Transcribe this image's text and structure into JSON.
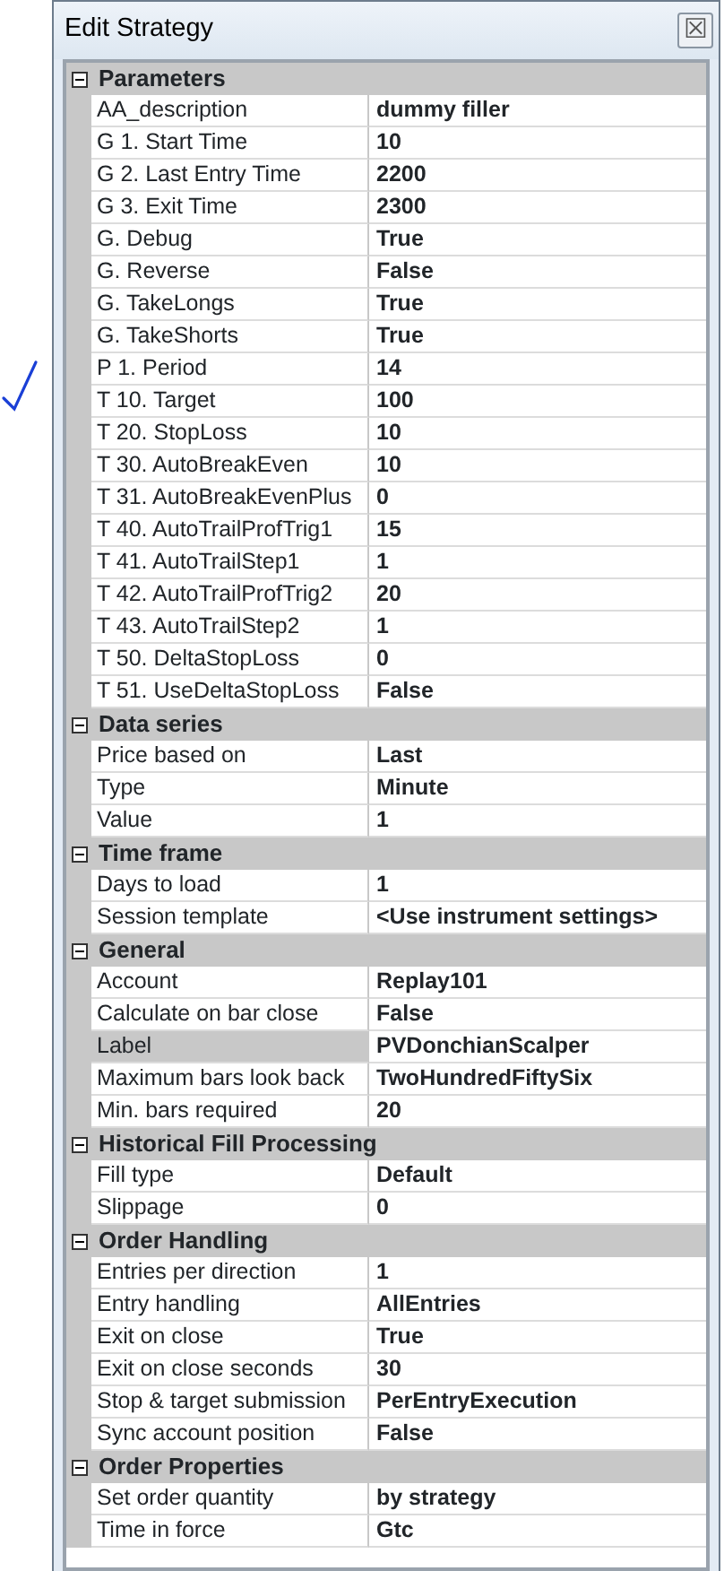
{
  "window": {
    "title": "Edit Strategy",
    "close": "☒"
  },
  "categories": [
    {
      "name": "Parameters",
      "expanded": true,
      "rows": [
        {
          "label": "AA_description",
          "value": "dummy filler",
          "selected": false
        },
        {
          "label": "G 1. Start Time",
          "value": "10",
          "selected": false
        },
        {
          "label": "G 2. Last Entry Time",
          "value": "2200",
          "selected": false
        },
        {
          "label": "G 3. Exit Time",
          "value": "2300",
          "selected": false
        },
        {
          "label": "G. Debug",
          "value": "True",
          "selected": false
        },
        {
          "label": "G. Reverse",
          "value": "False",
          "selected": false
        },
        {
          "label": "G. TakeLongs",
          "value": "True",
          "selected": false
        },
        {
          "label": "G. TakeShorts",
          "value": "True",
          "selected": false
        },
        {
          "label": "P 1. Period",
          "value": "14",
          "selected": false
        },
        {
          "label": "T 10. Target",
          "value": "100",
          "selected": false
        },
        {
          "label": "T 20. StopLoss",
          "value": "10",
          "selected": false
        },
        {
          "label": "T 30. AutoBreakEven",
          "value": "10",
          "selected": false
        },
        {
          "label": "T 31. AutoBreakEvenPlus",
          "value": "0",
          "selected": false
        },
        {
          "label": "T 40. AutoTrailProfTrig1",
          "value": "15",
          "selected": false
        },
        {
          "label": "T 41. AutoTrailStep1",
          "value": "1",
          "selected": false
        },
        {
          "label": "T 42. AutoTrailProfTrig2",
          "value": "20",
          "selected": false
        },
        {
          "label": "T 43. AutoTrailStep2",
          "value": "1",
          "selected": false
        },
        {
          "label": "T 50. DeltaStopLoss",
          "value": "0",
          "selected": false
        },
        {
          "label": "T 51. UseDeltaStopLoss",
          "value": "False",
          "selected": false
        }
      ]
    },
    {
      "name": "Data series",
      "expanded": true,
      "rows": [
        {
          "label": "Price based on",
          "value": "Last",
          "selected": false
        },
        {
          "label": "Type",
          "value": "Minute",
          "selected": false
        },
        {
          "label": "Value",
          "value": "1",
          "selected": false
        }
      ]
    },
    {
      "name": "Time frame",
      "expanded": true,
      "rows": [
        {
          "label": "Days to load",
          "value": "1",
          "selected": false
        },
        {
          "label": "Session template",
          "value": "<Use instrument settings>",
          "selected": false
        }
      ]
    },
    {
      "name": "General",
      "expanded": true,
      "rows": [
        {
          "label": "Account",
          "value": "Replay101",
          "selected": false
        },
        {
          "label": "Calculate on bar close",
          "value": "False",
          "selected": false
        },
        {
          "label": "Label",
          "value": "PVDonchianScalper",
          "selected": true
        },
        {
          "label": "Maximum bars look back",
          "value": "TwoHundredFiftySix",
          "selected": false
        },
        {
          "label": "Min. bars required",
          "value": "20",
          "selected": false
        }
      ]
    },
    {
      "name": "Historical Fill Processing",
      "expanded": true,
      "rows": [
        {
          "label": "Fill type",
          "value": "Default",
          "selected": false
        },
        {
          "label": "Slippage",
          "value": "0",
          "selected": false
        }
      ]
    },
    {
      "name": "Order Handling",
      "expanded": true,
      "rows": [
        {
          "label": "Entries per direction",
          "value": "1",
          "selected": false
        },
        {
          "label": "Entry handling",
          "value": "AllEntries",
          "selected": false
        },
        {
          "label": "Exit on close",
          "value": "True",
          "selected": false
        },
        {
          "label": "Exit on close seconds",
          "value": "30",
          "selected": false
        },
        {
          "label": "Stop & target submission",
          "value": "PerEntryExecution",
          "selected": false
        },
        {
          "label": "Sync account position",
          "value": "False",
          "selected": false
        }
      ]
    },
    {
      "name": "Order Properties",
      "expanded": true,
      "rows": [
        {
          "label": "Set order quantity",
          "value": "by strategy",
          "selected": false
        },
        {
          "label": "Time in force",
          "value": "Gtc",
          "selected": false
        }
      ]
    }
  ]
}
